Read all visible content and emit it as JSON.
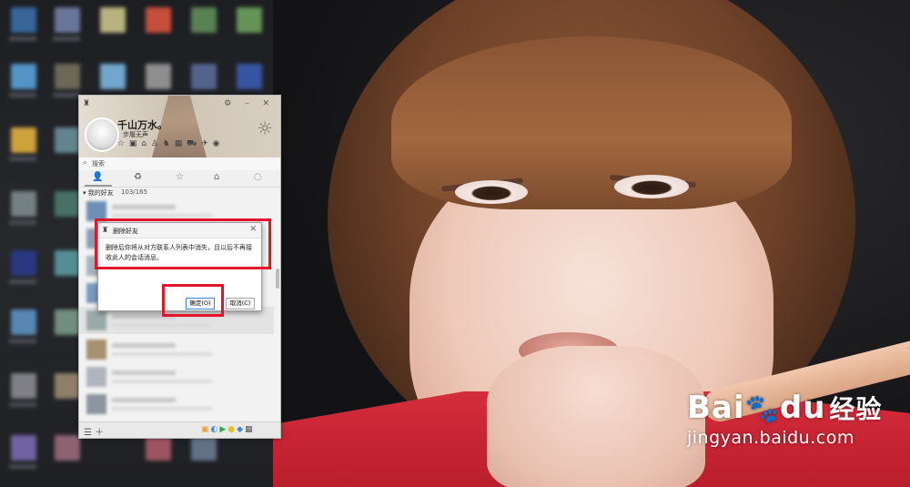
{
  "profile": {
    "nickname": "千山万水。",
    "signature": "步履无声"
  },
  "search": {
    "placeholder": "搜索"
  },
  "friends_group": {
    "name": "我的好友",
    "count": "103/165"
  },
  "dialog": {
    "title": "删除好友",
    "message": "删除后你将从对方联系人列表中消失，且以后不再接收此人的会话消息。",
    "ok_label": "确定(O)",
    "cancel_label": "取消(C)"
  },
  "watermark": {
    "brand_a": "Bai",
    "brand_b": "du",
    "brand_c": "经验",
    "url": "jingyan.baidu.com"
  },
  "colors": {
    "highlight_box": "#e0152a",
    "ok_button_border": "#3e89d8"
  }
}
